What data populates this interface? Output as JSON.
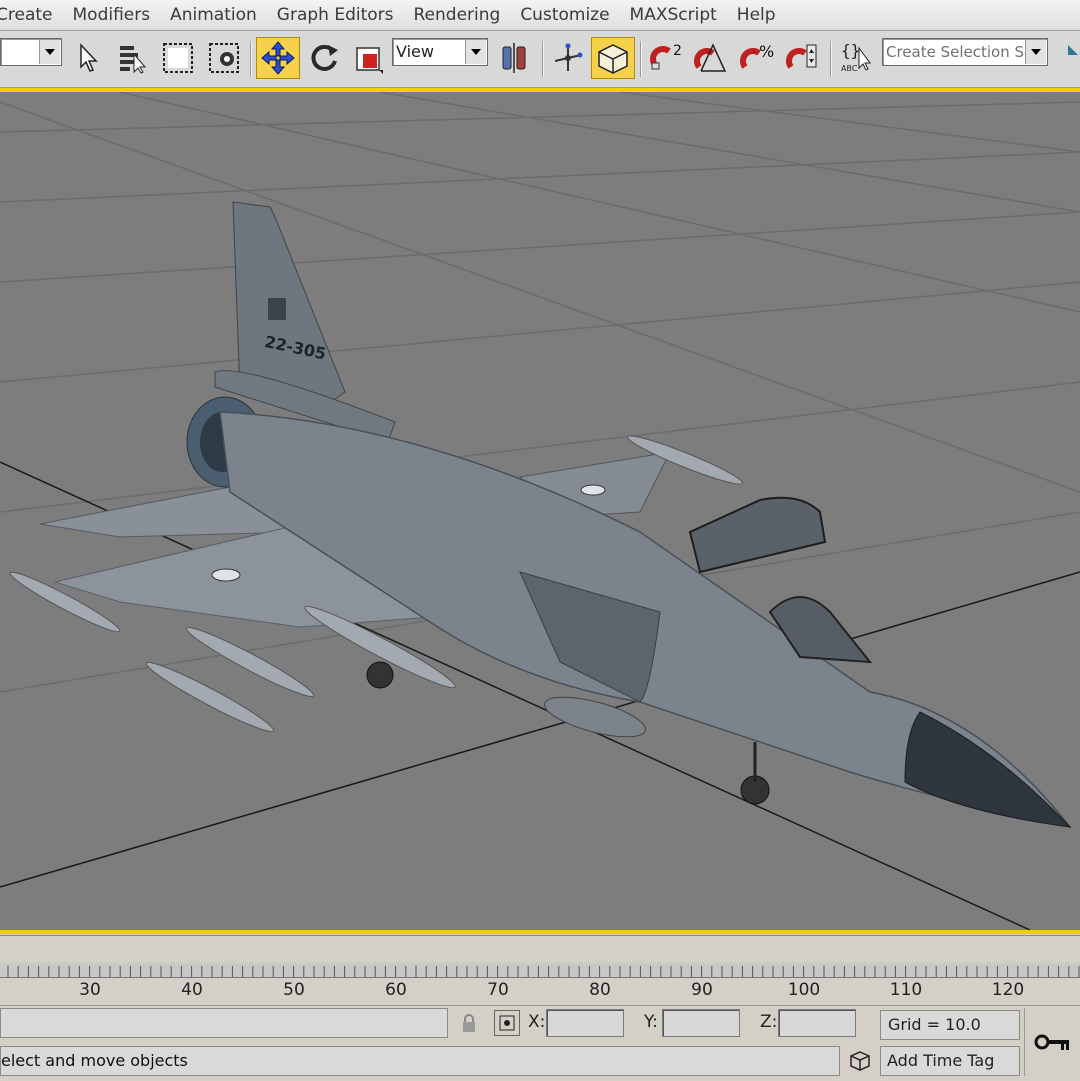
{
  "menu": {
    "items": [
      "Create",
      "Modifiers",
      "Animation",
      "Graph Editors",
      "Rendering",
      "Customize",
      "MAXScript",
      "Help"
    ]
  },
  "toolbar": {
    "reference_dropdown": "View",
    "selection_set_placeholder": "Create Selection Set",
    "active_tool": "select-and-move",
    "icons": [
      "select-object-icon",
      "select-by-name-icon",
      "rectangular-selection-icon",
      "window-crossing-icon",
      "select-and-move-icon",
      "select-and-rotate-icon",
      "select-and-scale-icon",
      "use-pivot-center-icon",
      "select-manipulate-icon",
      "keyboard-shortcut-icon",
      "snaps-toggle-icon",
      "angle-snap-icon",
      "percent-snap-icon",
      "spinner-snap-icon",
      "edit-named-selection-icon"
    ]
  },
  "viewport": {
    "aircraft_tail_number": "22-305"
  },
  "timeline": {
    "ticks": [
      "30",
      "40",
      "50",
      "60",
      "70",
      "80",
      "90",
      "100",
      "110",
      "120"
    ]
  },
  "status": {
    "x_label": "X:",
    "y_label": "Y:",
    "z_label": "Z:",
    "x_value": "",
    "y_value": "",
    "z_value": "",
    "grid": "Grid = 10.0",
    "prompt": "elect and move objects",
    "add_time_tag": "Add Time Tag"
  },
  "colors": {
    "viewport_bg": "#7d7d7d",
    "active_border": "#f2d000",
    "active_tool_bg": "#f6d24a"
  }
}
